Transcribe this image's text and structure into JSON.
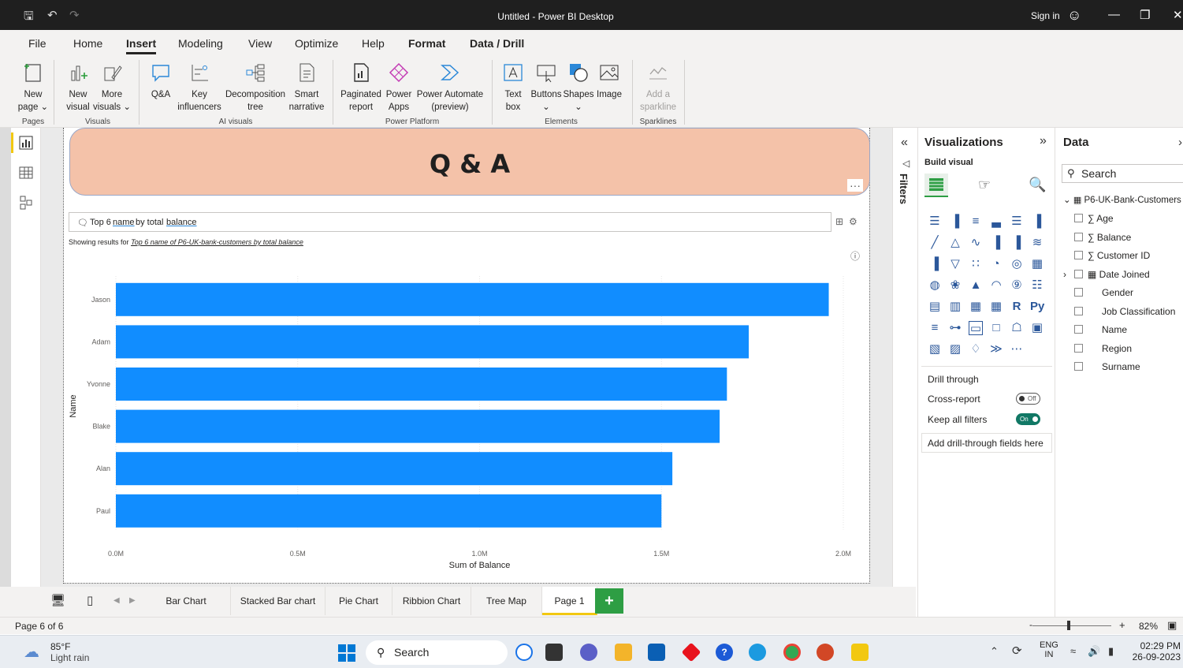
{
  "titlebar": {
    "title": "Untitled - Power BI Desktop",
    "sign_in": "Sign in"
  },
  "menu": {
    "file": "File",
    "home": "Home",
    "insert": "Insert",
    "modeling": "Modeling",
    "view": "View",
    "optimize": "Optimize",
    "help": "Help",
    "format": "Format",
    "data_drill": "Data / Drill"
  },
  "ribbon": {
    "new_page": "New",
    "new_page2": "page ⌄",
    "new_visual": "New",
    "new_visual2": "visual",
    "more_visuals": "More",
    "more_visuals2": "visuals ⌄",
    "qa": "Q&A",
    "key_infl": "Key",
    "key_infl2": "influencers",
    "decomp": "Decomposition",
    "decomp2": "tree",
    "smart": "Smart",
    "smart2": "narrative",
    "paginated": "Paginated",
    "paginated2": "report",
    "power_apps": "Power",
    "power_apps2": "Apps",
    "power_automate": "Power Automate",
    "power_automate2": "(preview)",
    "text_box": "Text",
    "text_box2": "box",
    "buttons": "Buttons",
    "buttons2": "⌄",
    "shapes": "Shapes",
    "shapes2": "⌄",
    "image": "Image",
    "sparkline": "Add a",
    "sparkline2": "sparkline",
    "groups": {
      "pages": "Pages",
      "visuals": "Visuals",
      "ai": "AI visuals",
      "platform": "Power Platform",
      "elements": "Elements",
      "sparklines": "Sparklines"
    }
  },
  "banner": {
    "title": "Q & A"
  },
  "qa": {
    "prefix": "Top 6",
    "w_name": "name",
    "mid": "by total",
    "w_balance": "balance",
    "showing": "Showing results for",
    "showing_link": "Top 6 name of P6-UK-bank-customers by total balance"
  },
  "chart_data": {
    "type": "bar",
    "orientation": "horizontal",
    "categories": [
      "Jason",
      "Adam",
      "Yvonne",
      "Blake",
      "Alan",
      "Paul"
    ],
    "values": [
      1.96,
      1.74,
      1.68,
      1.66,
      1.53,
      1.5
    ],
    "xlabel": "Sum of Balance",
    "ylabel": "Name",
    "xlim": [
      0,
      2.0
    ],
    "xticks": [
      "0.0M",
      "0.5M",
      "1.0M",
      "1.5M",
      "2.0M"
    ],
    "color": "#118dff",
    "grid": true
  },
  "tabs": [
    "Bar Chart",
    "Stacked Bar chart",
    "Pie Chart",
    "Ribbion Chart",
    "Tree Map",
    "Page 1"
  ],
  "status": {
    "page": "Page 6 of 6",
    "zoom": "82%"
  },
  "panes": {
    "filters": "Filters",
    "visualizations": "Visualizations",
    "build_visual": "Build visual",
    "drill_through": "Drill through",
    "cross_report": "Cross-report",
    "cross_state": "Off",
    "keep_filters": "Keep all filters",
    "keep_state": "On",
    "add_drill": "Add drill-through fields here",
    "data": "Data",
    "search": "Search",
    "table": "P6-UK-Bank-Customers",
    "fields": [
      "Age",
      "Balance",
      "Customer ID",
      "Date Joined",
      "Gender",
      "Job Classification",
      "Name",
      "Region",
      "Surname"
    ]
  },
  "taskbar": {
    "temp": "85°F",
    "weather": "Light rain",
    "search": "Search",
    "lang": "ENG",
    "lang2": "IN",
    "time": "02:29 PM",
    "date": "26-09-2023"
  },
  "colors": {
    "accent": "#f2c811",
    "bar": "#118dff",
    "banner": "#f4c2a9",
    "titlebar": "#1f1f1f"
  }
}
